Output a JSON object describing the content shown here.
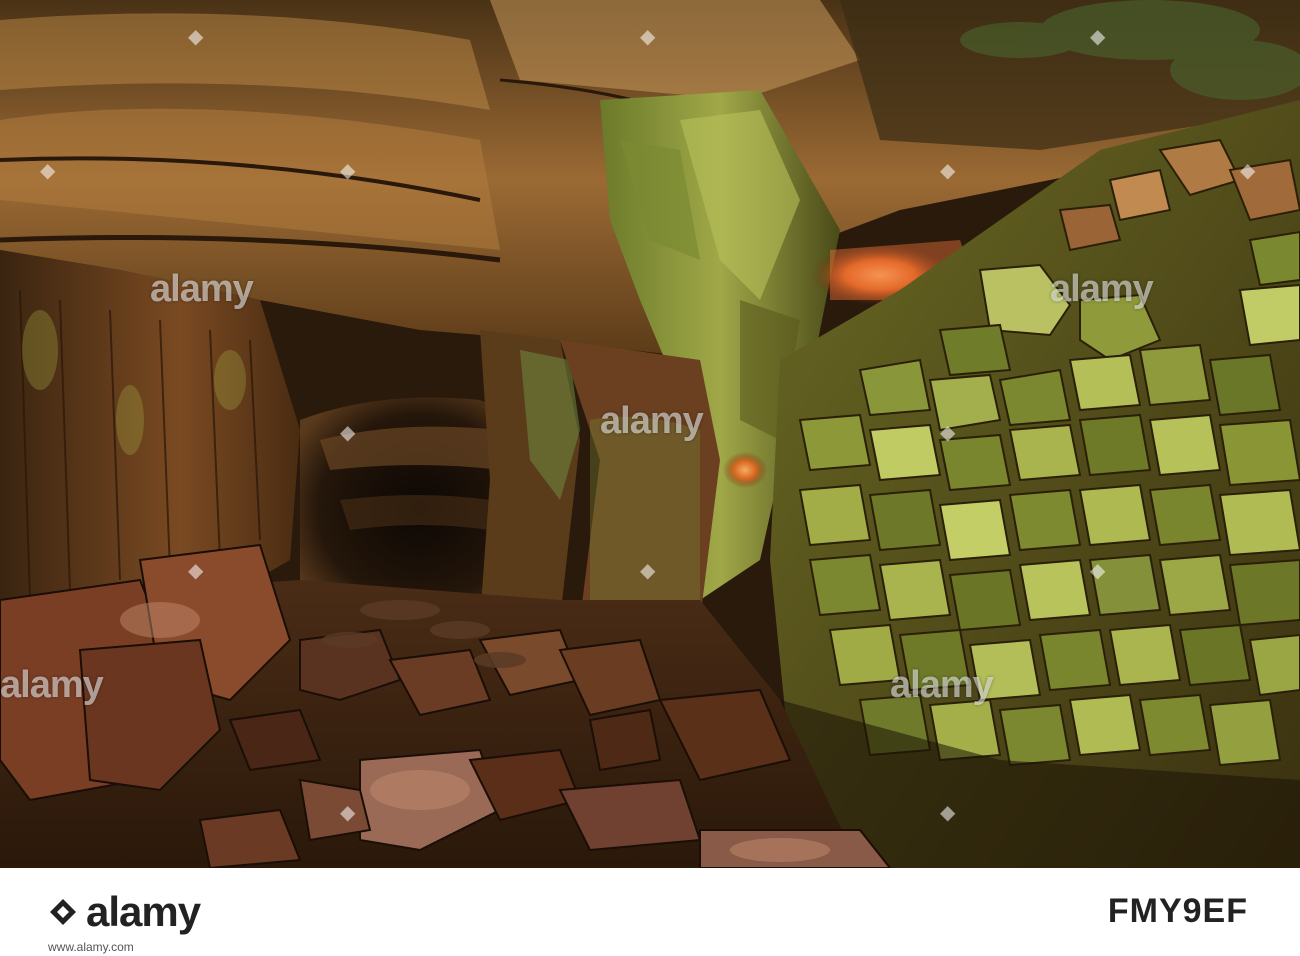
{
  "photo": {
    "description_icon": "cave-photo",
    "watermark_text": "alamy",
    "palette": {
      "rock_dark": "#2a1a0c",
      "rock_mid": "#8a5530",
      "rock_light": "#c9944f",
      "moss": "#8fa23a",
      "moss_light": "#c3cf6a",
      "glow_orange": "#f07a2a",
      "tunnel_dark": "#140c06"
    }
  },
  "footer": {
    "logo_text": "alamy",
    "image_code": "FMY9EF",
    "url": "www.alamy.com"
  }
}
